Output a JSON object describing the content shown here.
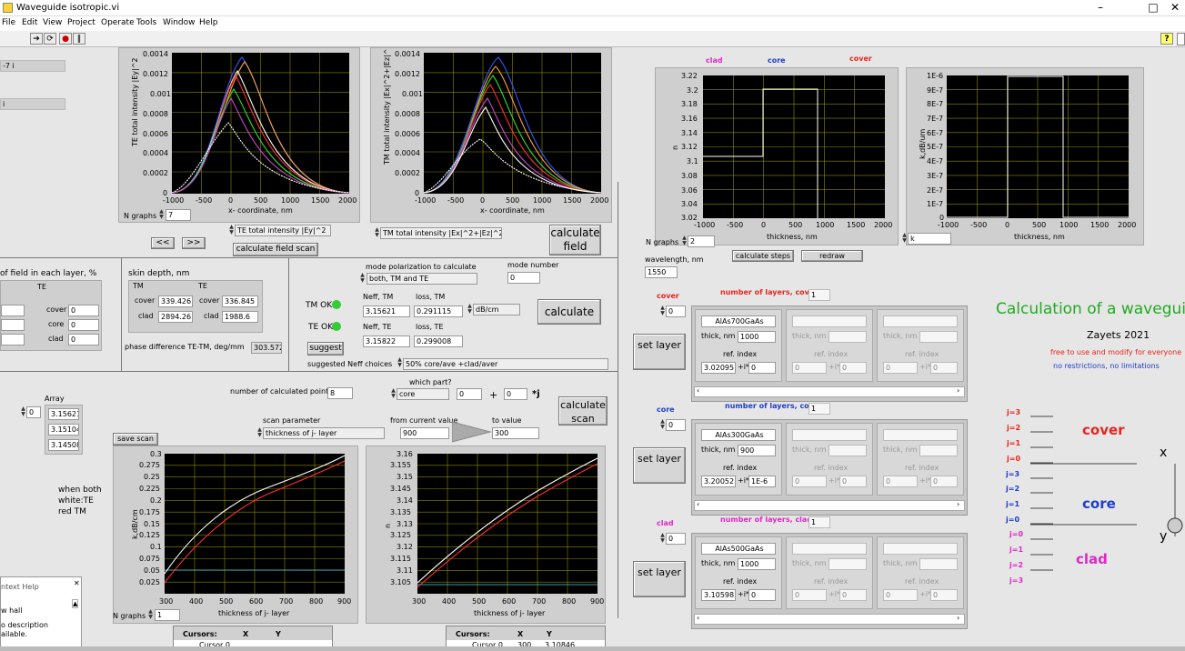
{
  "window": {
    "title": "Waveguide isotropic.vi"
  },
  "menus": [
    "File",
    "Edit",
    "View",
    "Project",
    "Operate",
    "Tools",
    "Window",
    "Help"
  ],
  "left_stub": {
    "f1": "-7 i",
    "f2": "i"
  },
  "te_graph": {
    "ylabel": "TE total intensity |Ey|^2",
    "xlabel": "x- coordinate, nm",
    "yticks": [
      "0.0014",
      "0.0012",
      "0.001",
      "0.0008",
      "0.0006",
      "0.0004",
      "0.0002",
      "0"
    ],
    "xticks": [
      "-1000",
      "-500",
      "0",
      "500",
      "1000",
      "1500",
      "2000"
    ],
    "ngraphs_label": "N graphs",
    "ngraphs": "7",
    "plot_select": "TE total intensity |Ey|^2"
  },
  "tm_graph": {
    "ylabel": "TM total intensity |Ex|^2+|Ez|^2",
    "xlabel": "x- coordinate, nm",
    "yticks": [
      "0.0014",
      "0.0012",
      "0.001",
      "0.0008",
      "0.0006",
      "0.0004",
      "0.0002",
      "0"
    ],
    "xticks": [
      "-1000",
      "-500",
      "0",
      "500",
      "1000",
      "1500",
      "2000"
    ],
    "plot_select": "TM total intensity |Ex|^2+|Ez|^2"
  },
  "nav": {
    "prev": "<<",
    "next": ">>",
    "calc_field_scan": "calculate field scan",
    "calc_field": "calculate field"
  },
  "field_fraction": {
    "title": "of field in each layer, %",
    "te": "TE",
    "rows": [
      {
        "name": "cover",
        "val": "0"
      },
      {
        "name": "core",
        "val": "0"
      },
      {
        "name": "clad",
        "val": "0"
      }
    ]
  },
  "skin": {
    "title": "skin depth, nm",
    "tm": "TM",
    "te": "TE",
    "tm_rows": [
      {
        "name": "cover",
        "val": "339.426"
      },
      {
        "name": "clad",
        "val": "2894.26"
      }
    ],
    "te_rows": [
      {
        "name": "cover",
        "val": "336.845"
      },
      {
        "name": "clad",
        "val": "1988.6"
      }
    ],
    "phase_label": "phase difference TE-TM, deg/mm",
    "phase_val": "303.572"
  },
  "mode": {
    "pol_label": "mode polarization to calculate",
    "pol_val": "both, TM and TE",
    "num_label": "mode number",
    "num_val": "0",
    "tm_ok": "TM OK",
    "te_ok": "TE OK",
    "neff_tm_label": "Neff, TM",
    "loss_tm_label": "loss, TM",
    "neff_tm": "3.15621",
    "loss_tm": "0.291115",
    "unit": "dB/cm",
    "neff_te_label": "Neff, TE",
    "loss_te_label": "loss, TE",
    "neff_te": "3.15822",
    "loss_te": "0.299008",
    "calculate": "calculate",
    "suggest": "suggest",
    "suggested_label": "suggested Neff choices",
    "suggested_val": "50% core/ave +clad/aver"
  },
  "array": {
    "label": "Array",
    "index": "0",
    "values": [
      "3.15621",
      "3.15104",
      "3.14508"
    ]
  },
  "scan": {
    "npoints_label": "number of calculated points",
    "npoints": "8",
    "which_label": "which part?",
    "which_val": "core",
    "re": "0",
    "plus": "+",
    "im": "0",
    "j": "*j",
    "calc_scan": "calculate scan",
    "save_scan": "save scan",
    "param_label": "scan parameter",
    "param_val": "thickness of j- layer",
    "from_label": "from current value",
    "from_val": "900",
    "to_label": "to value",
    "to_val": "300"
  },
  "note": {
    "l1": "when both",
    "l2": "white:TE",
    "l3": "red TM"
  },
  "help": {
    "title": "ntext Help",
    "l1": "w hall",
    "l2": "o description",
    "l3": "ailable."
  },
  "loss_graph": {
    "ylabel": "k,dB/cm",
    "xlabel": "thickness of j- layer",
    "yticks": [
      "0.3",
      "0.275",
      "0.25",
      "0.225",
      "0.2",
      "0.175",
      "0.15",
      "0.125",
      "0.1",
      "0.075",
      "0.05",
      "0.025"
    ],
    "xticks": [
      "300",
      "400",
      "500",
      "600",
      "700",
      "800",
      "900"
    ],
    "ngraphs": "1",
    "ngraphs_label": "N graphs"
  },
  "neff_graph": {
    "ylabel": "n",
    "xlabel": "thickness of j- layer",
    "yticks": [
      "3.16",
      "3.155",
      "3.15",
      "3.145",
      "3.14",
      "3.135",
      "3.13",
      "3.125",
      "3.12",
      "3.115",
      "3.11",
      "3.105"
    ],
    "xticks": [
      "300",
      "400",
      "500",
      "600",
      "700",
      "800",
      "900"
    ]
  },
  "cursors1": {
    "h": "Cursors:",
    "x": "X",
    "y": "Y",
    "row": "Cursor 0"
  },
  "cursors2": {
    "h": "Cursors:",
    "x": "X",
    "y": "Y",
    "row": "Cursor 0",
    "xv": "300",
    "yv": "3.10846"
  },
  "profile": {
    "clad": "clad",
    "core": "core",
    "cover": "cover",
    "ylabel": "n",
    "xlabel": "thickness, nm",
    "yticks": [
      "3.22",
      "3.2",
      "3.18",
      "3.16",
      "3.14",
      "3.12",
      "3.1",
      "3.08",
      "3.06",
      "3.04",
      "3.02"
    ],
    "xticks": [
      "-1000",
      "-500",
      "0",
      "500",
      "1000",
      "1500",
      "2000"
    ],
    "ngraphs_label": "N graphs",
    "ngraphs": "2",
    "calc_steps": "calculate steps",
    "redraw": "redraw",
    "wl_label": "wavelength, nm",
    "wl": "1550"
  },
  "kprofile": {
    "ylabel": "k,dB/um",
    "xlabel": "thickness, nm",
    "yticks": [
      "1E-6",
      "9E-7",
      "8E-7",
      "7E-7",
      "6E-7",
      "5E-7",
      "4E-7",
      "3E-7",
      "2E-7",
      "1E-7",
      "0"
    ],
    "xticks": [
      "-1000",
      "-500",
      "0",
      "500",
      "1000",
      "1500",
      "2000"
    ],
    "select": "k"
  },
  "layers": [
    {
      "name": "cover",
      "nlabel": "number of layers, cover",
      "n": "1",
      "idx": "0",
      "mat": "AlAs700GaAs",
      "thick": "1000",
      "ri": "3.02095",
      "im": "0"
    },
    {
      "name": "core",
      "nlabel": "number of layers, core",
      "n": "1",
      "idx": "0",
      "mat": "AlAs300GaAs",
      "thick": "900",
      "ri": "3.20052",
      "im": "1E-6"
    },
    {
      "name": "clad",
      "nlabel": "number of layers, clad",
      "n": "1",
      "idx": "0",
      "mat": "AlAs500GaAs",
      "thick": "1000",
      "ri": "3.10598",
      "im": "0"
    }
  ],
  "layer_labels": {
    "thick": "thick, nm",
    "ri": "ref. index",
    "pi": "+i*",
    "set": "set layer",
    "zero": "0"
  },
  "info": {
    "title": "Calculation of a waveguide",
    "author": "Zayets 2021",
    "l1": "free to use and modify for everyone",
    "l2": "no restrictions, no limitations"
  },
  "diagram": {
    "cover": "cover",
    "core": "core",
    "clad": "clad",
    "x": "x",
    "y": "y",
    "j_cover": [
      "j=3",
      "j=2",
      "j=1",
      "j=0"
    ],
    "j_core": [
      "j=3",
      "j=2",
      "j=1",
      "j=0"
    ],
    "j_clad": [
      "j=0",
      "j=1",
      "j=2",
      "j=3"
    ]
  },
  "colors": {
    "cover": "#e8261f",
    "core": "#1f3ecf",
    "clad": "#e028c8",
    "green": "#22aa22"
  }
}
